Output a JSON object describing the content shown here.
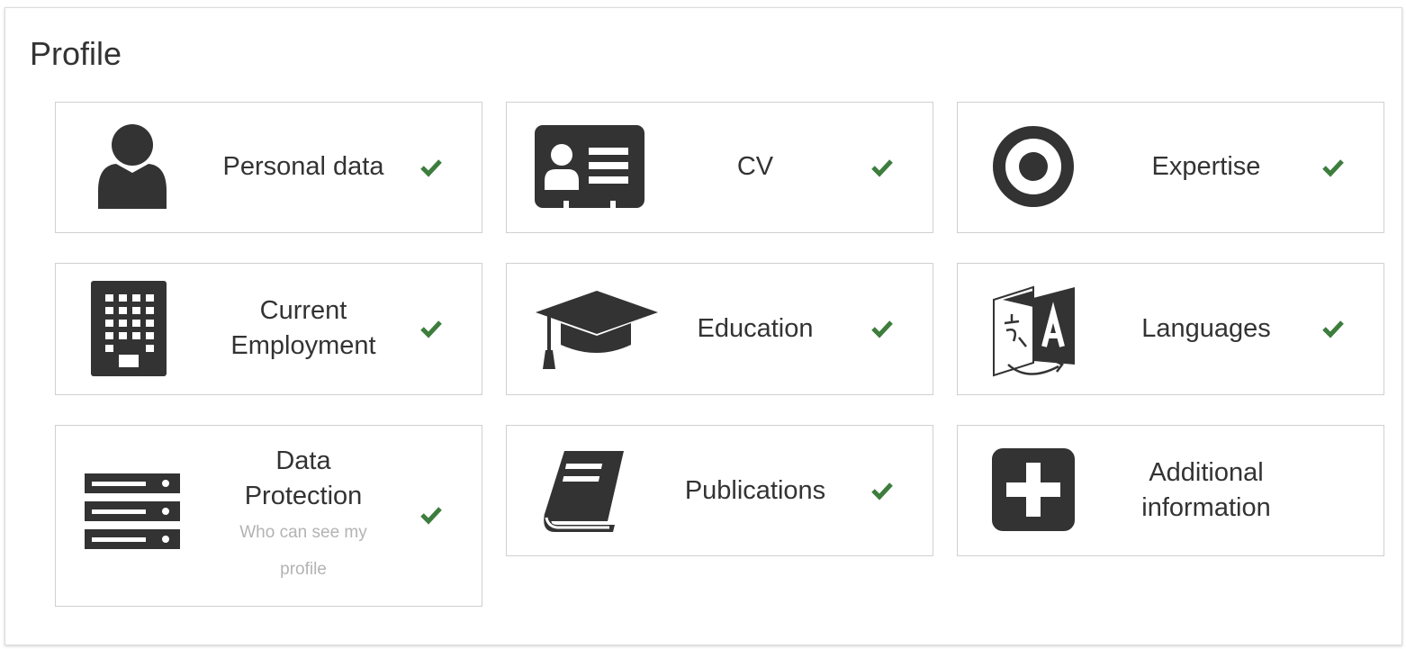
{
  "title": "Profile",
  "accent_check_color": "#3d7d3d",
  "icon_color": "#333333",
  "cards": [
    {
      "name": "Personal data",
      "icon": "user-icon",
      "done": true
    },
    {
      "name": "CV",
      "icon": "id-card-icon",
      "done": true
    },
    {
      "name": "Expertise",
      "icon": "target-icon",
      "done": true
    },
    {
      "name": "Current Employment",
      "icon": "building-icon",
      "done": true
    },
    {
      "name": "Education",
      "icon": "graduation-cap-icon",
      "done": true
    },
    {
      "name": "Languages",
      "icon": "language-icon",
      "done": true
    },
    {
      "name": "Data Protection",
      "sub": "Who can see my profile",
      "icon": "server-icon",
      "done": true
    },
    {
      "name": "Publications",
      "icon": "book-icon",
      "done": true
    },
    {
      "name": "Additional information",
      "icon": "plus-square-icon",
      "done": false
    }
  ],
  "labels": {
    "personal_data": "Personal data",
    "cv": "CV",
    "expertise": "Expertise",
    "current": "Current",
    "employment": "Employment",
    "education": "Education",
    "languages": "Languages",
    "data": "Data",
    "protection": "Protection",
    "who_can_see": "Who can see my",
    "profile_word": "profile",
    "publications": "Publications",
    "additional": "Additional",
    "information": "information"
  }
}
